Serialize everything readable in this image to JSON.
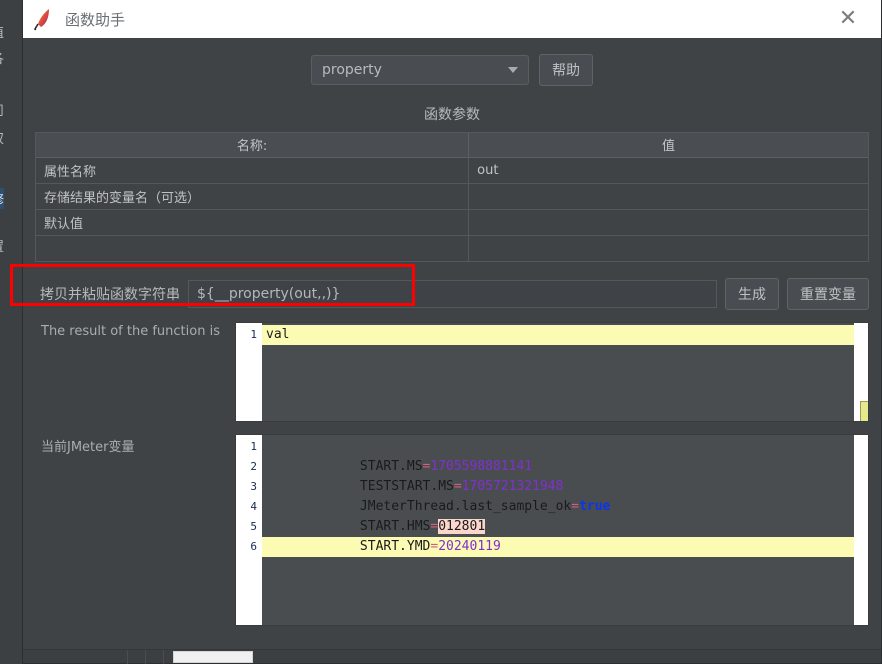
{
  "background_window": {
    "name": "jmeter-main-window-behind",
    "edge_glyphs": [
      "值",
      "各",
      "司",
      "双",
      "修",
      "置"
    ]
  },
  "dialog": {
    "title": "函数助手",
    "app_icon": "jmeter-feather-icon",
    "close_label": "✕",
    "function_select": {
      "selected": "property",
      "caret_icon": "chevron-down-icon"
    },
    "help_button": "帮助",
    "section_title": "函数参数",
    "params_table": {
      "headers": [
        "名称:",
        "值"
      ],
      "rows": [
        {
          "name": "属性名称",
          "value": "out"
        },
        {
          "name": "存储结果的变量名（可选）",
          "value": ""
        },
        {
          "name": "默认值",
          "value": ""
        }
      ]
    },
    "copy_paste": {
      "label": "拷贝并粘贴函数字符串",
      "value": "${__property(out,,)}",
      "generate_button": "生成",
      "reset_button": "重置变量"
    },
    "result_panel": {
      "label": "The result of the function is",
      "lines": [
        {
          "num": "1",
          "text": "val",
          "cursor": true
        }
      ]
    },
    "variables_panel": {
      "label": "当前JMeter变量",
      "lines": [
        {
          "num": "1",
          "key": "START.MS",
          "eq": "=",
          "value": "1705598881141",
          "type": "num",
          "cursor": false
        },
        {
          "num": "2",
          "key": "TESTSTART.MS",
          "eq": "=",
          "value": "1705721321948",
          "type": "num",
          "cursor": false
        },
        {
          "num": "3",
          "key": "JMeterThread.last_sample_ok",
          "eq": "=",
          "value": "true",
          "type": "bool",
          "cursor": false
        },
        {
          "num": "4",
          "key": "START.HMS",
          "eq": "=",
          "value": "012801",
          "type": "highlight",
          "cursor": false
        },
        {
          "num": "5",
          "key": "START.YMD",
          "eq": "=",
          "value": "20240119",
          "type": "num",
          "cursor": false
        },
        {
          "num": "6",
          "key": "",
          "eq": "",
          "value": "",
          "type": "empty",
          "cursor": true
        }
      ]
    },
    "annotation": {
      "name": "red-highlight-rectangle",
      "color": "#ff0000"
    }
  },
  "colors": {
    "dialog_bg": "#404346",
    "titlebar_bg": "#ffffff",
    "accent_red": "#ff0000",
    "cursor_line": "#fbfbb4",
    "value_purple": "#8030d0",
    "value_blue": "#0b34ef",
    "highlight_pink": "#fbd6cc"
  }
}
